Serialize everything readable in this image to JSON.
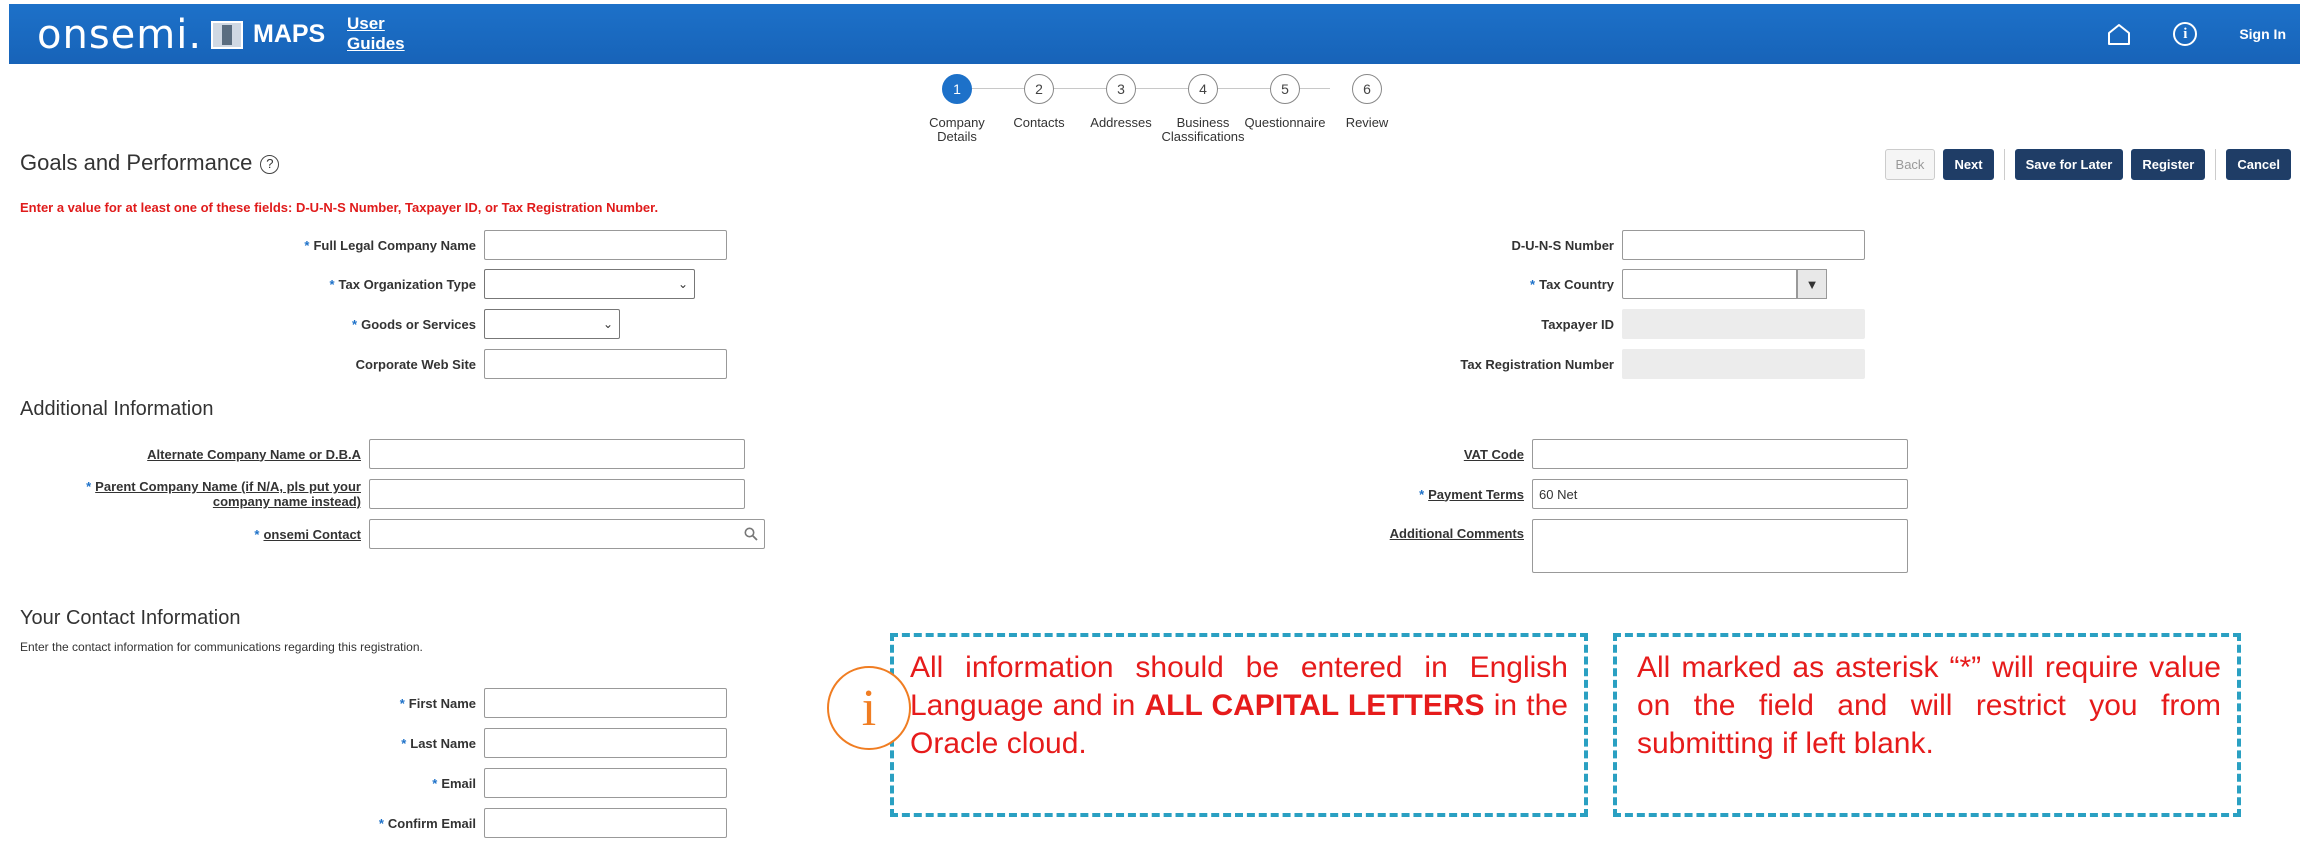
{
  "header": {
    "logo": "onsemi.",
    "app_name": "MAPS",
    "guides_line1": "User",
    "guides_line2": "Guides",
    "signin": "Sign In"
  },
  "train": {
    "steps": [
      {
        "num": "1",
        "label": "Company Details"
      },
      {
        "num": "2",
        "label": "Contacts"
      },
      {
        "num": "3",
        "label": "Addresses"
      },
      {
        "num": "4",
        "label": "Business Classifications"
      },
      {
        "num": "5",
        "label": "Questionnaire"
      },
      {
        "num": "6",
        "label": "Review"
      }
    ]
  },
  "page": {
    "title": "Goals and Performance",
    "help": "?",
    "error": "Enter a value for at least one of these fields: D-U-N-S Number, Taxpayer ID, or Tax Registration Number."
  },
  "actions": {
    "back": "Back",
    "next": "Next",
    "save_later": "Save for Later",
    "register": "Register",
    "cancel": "Cancel"
  },
  "company": {
    "legal_name_label": "Full Legal Company Name",
    "tax_org_label": "Tax Organization Type",
    "goods_label": "Goods or Services",
    "website_label": "Corporate Web Site",
    "duns_label": "D-U-N-S Number",
    "tax_country_label": "Tax Country",
    "taxpayer_label": "Taxpayer ID",
    "tax_reg_label": "Tax Registration Number"
  },
  "additional": {
    "section_title": "Additional Information",
    "alt_name_label": "Alternate Company Name or D.B.A",
    "parent_label_1": "Parent Company Name (if N/A, pls put your",
    "parent_label_2": "company name instead)",
    "contact_label": "onsemi Contact",
    "vat_label": "VAT Code",
    "payment_terms_label": "Payment Terms",
    "payment_terms_value": "60 Net",
    "comments_label": "Additional Comments"
  },
  "contact": {
    "section_title": "Your Contact Information",
    "note": "Enter the contact information for communications regarding this registration.",
    "first_name_label": "First Name",
    "last_name_label": "Last Name",
    "email_label": "Email",
    "confirm_email_label": "Confirm Email"
  },
  "callouts": {
    "left_1": "All information should be entered in English Language and in ",
    "left_bold": "ALL CAPITAL LETTERS",
    "left_2": " in the Oracle cloud.",
    "right": "All marked as asterisk “*” will require value on the field and will restrict you from submitting if left blank."
  },
  "colors": {
    "header_blue": "#1d71c9",
    "button_navy": "#1f3d66",
    "error_red": "#e01b1b",
    "callout_border": "#2aa0c2",
    "info_orange": "#f07d22"
  }
}
